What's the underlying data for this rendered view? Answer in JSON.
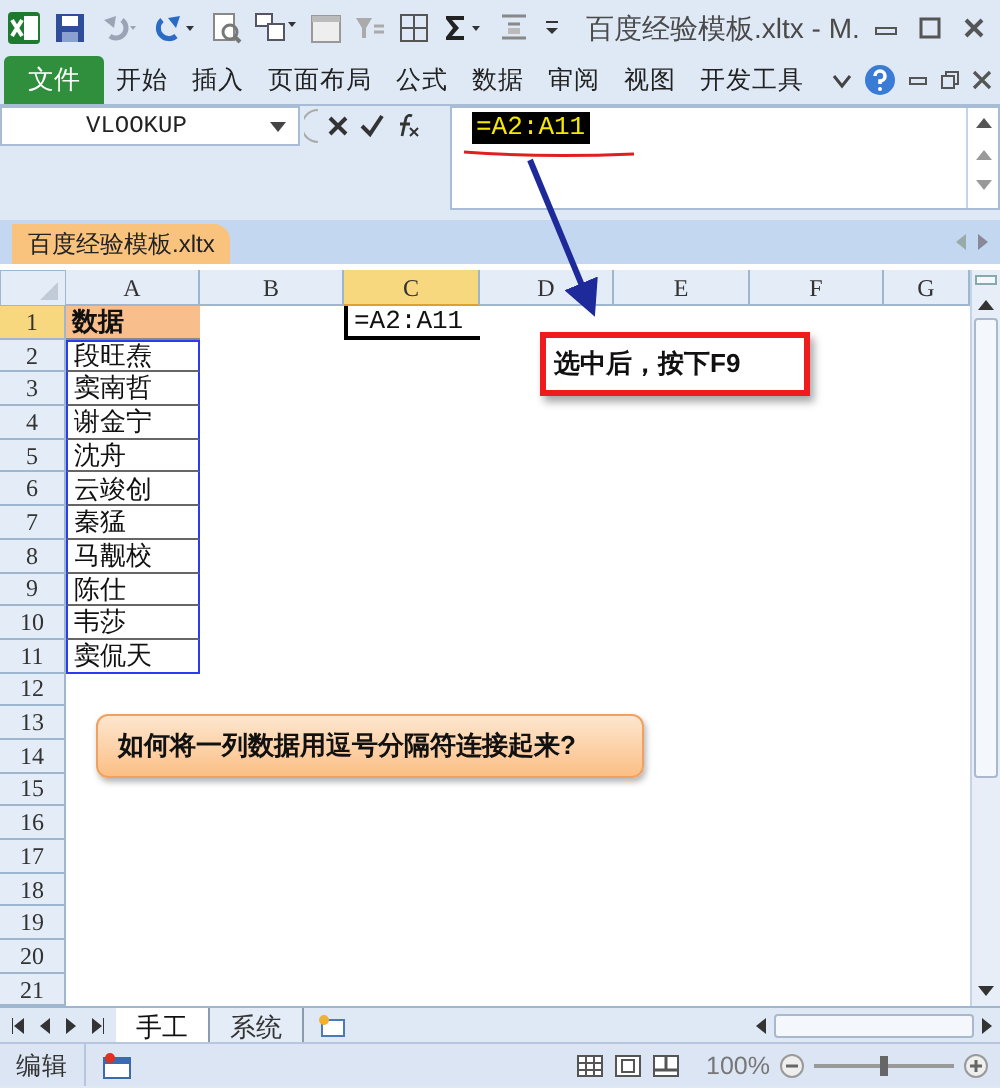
{
  "window": {
    "title": "百度经验模板.xltx - M."
  },
  "ribbon": {
    "file_button": "文件",
    "tabs": [
      "开始",
      "插入",
      "页面布局",
      "公式",
      "数据",
      "审阅",
      "视图",
      "开发工具"
    ]
  },
  "formula_bar": {
    "name_box": "VLOOKUP",
    "formula": "=A2:A11"
  },
  "workbook_tab": "百度经验模板.xltx",
  "sheet": {
    "columns": [
      {
        "label": "A",
        "selected": false
      },
      {
        "label": "B",
        "selected": false
      },
      {
        "label": "C",
        "selected": true
      },
      {
        "label": "D",
        "selected": false
      },
      {
        "label": "E",
        "selected": false
      },
      {
        "label": "F",
        "selected": false
      },
      {
        "label": "G",
        "selected": false
      }
    ],
    "rows": [
      {
        "number": "1",
        "selected": true,
        "kind": "header",
        "referenced": false,
        "cells": [
          "数据",
          "",
          "=A2:A11"
        ]
      },
      {
        "number": "2",
        "selected": false,
        "kind": "data",
        "referenced": true,
        "cells": [
          "段旺焘"
        ]
      },
      {
        "number": "3",
        "selected": false,
        "kind": "data",
        "referenced": true,
        "cells": [
          "窦南哲"
        ]
      },
      {
        "number": "4",
        "selected": false,
        "kind": "data",
        "referenced": true,
        "cells": [
          "谢金宁"
        ]
      },
      {
        "number": "5",
        "selected": false,
        "kind": "data",
        "referenced": true,
        "cells": [
          "沈舟"
        ]
      },
      {
        "number": "6",
        "selected": false,
        "kind": "data",
        "referenced": true,
        "cells": [
          "云竣创"
        ]
      },
      {
        "number": "7",
        "selected": false,
        "kind": "data",
        "referenced": true,
        "cells": [
          "秦猛"
        ]
      },
      {
        "number": "8",
        "selected": false,
        "kind": "data",
        "referenced": true,
        "cells": [
          "马觏校"
        ]
      },
      {
        "number": "9",
        "selected": false,
        "kind": "data",
        "referenced": true,
        "cells": [
          "陈仕"
        ]
      },
      {
        "number": "10",
        "selected": false,
        "kind": "data",
        "referenced": true,
        "cells": [
          "韦莎"
        ]
      },
      {
        "number": "11",
        "selected": false,
        "kind": "data",
        "referenced": true,
        "cells": [
          "窦侃天"
        ]
      },
      {
        "number": "12",
        "selected": false
      },
      {
        "number": "13",
        "selected": false
      },
      {
        "number": "14",
        "selected": false
      },
      {
        "number": "15",
        "selected": false
      },
      {
        "number": "16",
        "selected": false
      },
      {
        "number": "17",
        "selected": false
      },
      {
        "number": "18",
        "selected": false
      },
      {
        "number": "19",
        "selected": false
      },
      {
        "number": "20",
        "selected": false
      },
      {
        "number": "21",
        "selected": false
      }
    ]
  },
  "annotations": [
    {
      "kind": "callout",
      "text": "选中后，按下F9"
    },
    {
      "kind": "banner",
      "text": "如何将一列数据用逗号分隔符连接起来?"
    }
  ],
  "sheet_tabs": [
    {
      "label": "手工",
      "selected": true
    },
    {
      "label": "系统",
      "selected": false
    }
  ],
  "status_bar": {
    "mode": "编辑",
    "zoom": "100%",
    "zoom_slider": {
      "level": 0.5
    }
  }
}
